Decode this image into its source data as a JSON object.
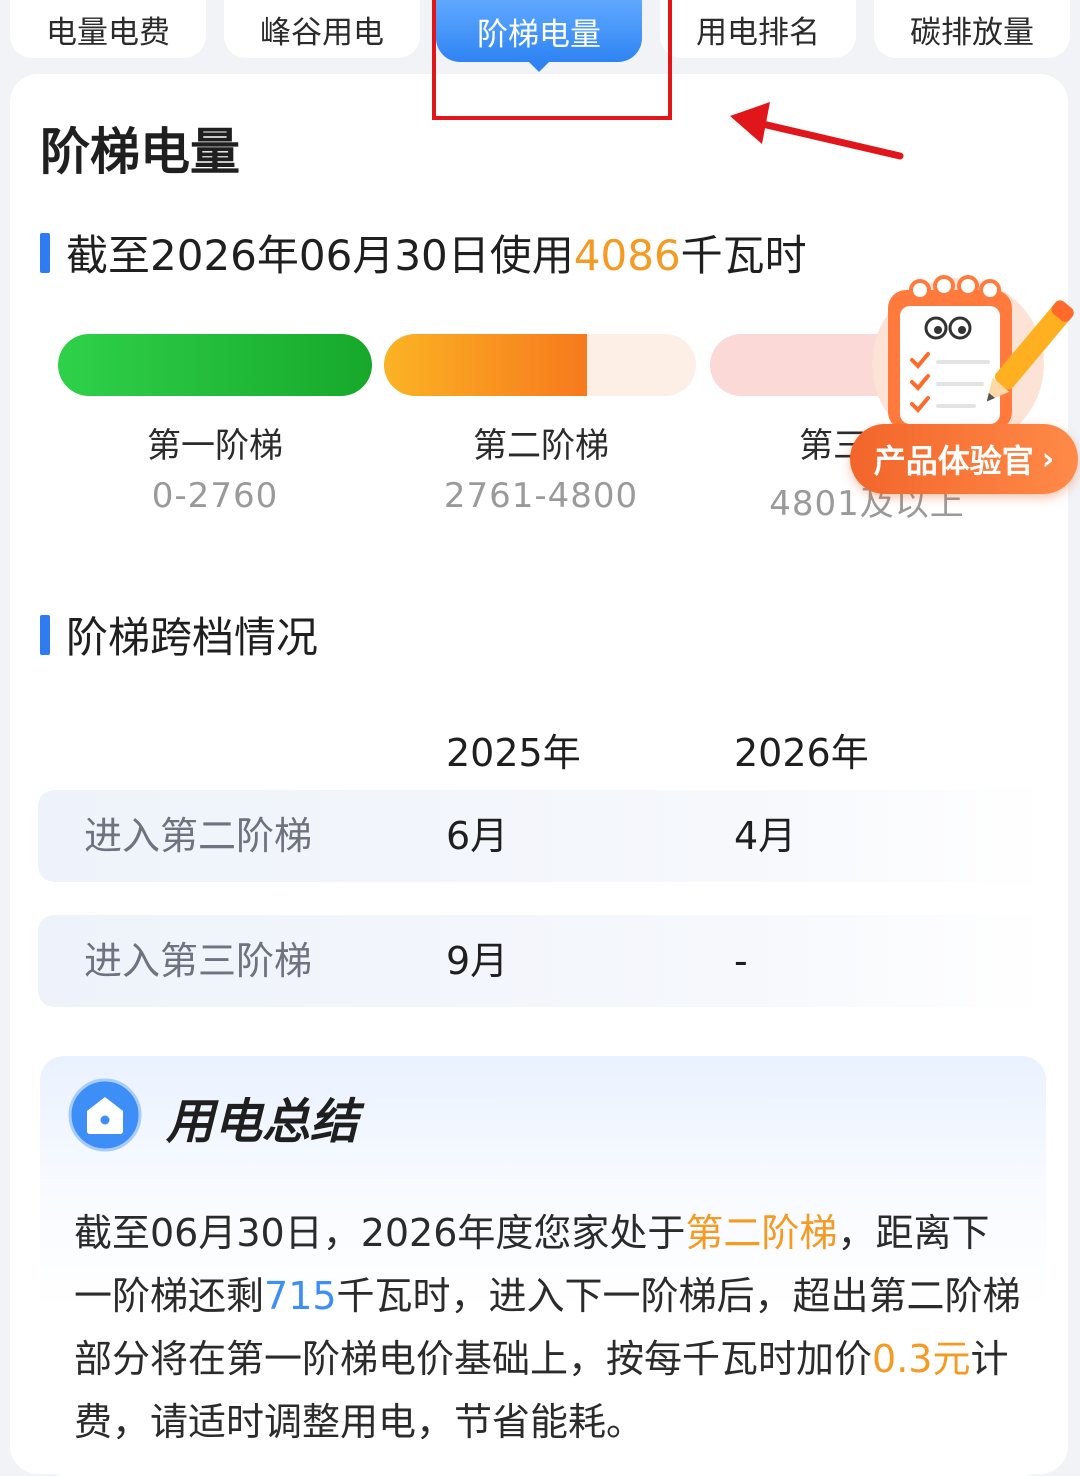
{
  "tabs": [
    {
      "label": "电量电费"
    },
    {
      "label": "峰谷用电"
    },
    {
      "label": "阶梯电量"
    },
    {
      "label": "用电排名"
    },
    {
      "label": "碳排放量"
    }
  ],
  "page_title": "阶梯电量",
  "usage": {
    "prefix": "截至2026年06月30日使用",
    "value": "4086",
    "unit": "千瓦时"
  },
  "tiers": [
    {
      "name": "第一阶梯",
      "range": "0-2760",
      "fill": 1.0,
      "color": "#22c23a"
    },
    {
      "name": "第二阶梯",
      "range": "2761-4800",
      "fill": 0.65,
      "color": "#f7941d"
    },
    {
      "name": "第三阶梯",
      "range": "4801及以上",
      "fill": 0.0,
      "color": "#f9c7c2"
    }
  ],
  "badge": {
    "label": "产品体验官",
    "chevron": "›",
    "icon": "checklist-notepad-icon"
  },
  "crossing": {
    "title": "阶梯跨档情况",
    "years": [
      "2025年",
      "2026年"
    ],
    "rows": [
      {
        "label": "进入第二阶梯",
        "y2025": "6月",
        "y2026": "4月"
      },
      {
        "label": "进入第三阶梯",
        "y2025": "9月",
        "y2026": "-"
      }
    ]
  },
  "summary": {
    "title": "用电总结",
    "icon": "home-icon",
    "p1": "截至06月30日，2026年度您家处于",
    "tier": "第二阶梯",
    "p2": "，距离下一阶梯还剩",
    "remaining": "715",
    "p3": "千瓦时，进入下一阶梯后，超出第二阶梯部分将在第一阶梯电价基础上，按每千瓦时加价",
    "price": "0.3元",
    "p4": "计费，请适时调整用电，节省能耗。"
  },
  "colors": {
    "accent": "#2f7bf0",
    "highlight": "#f59a23",
    "annotation": "#e0161b"
  }
}
